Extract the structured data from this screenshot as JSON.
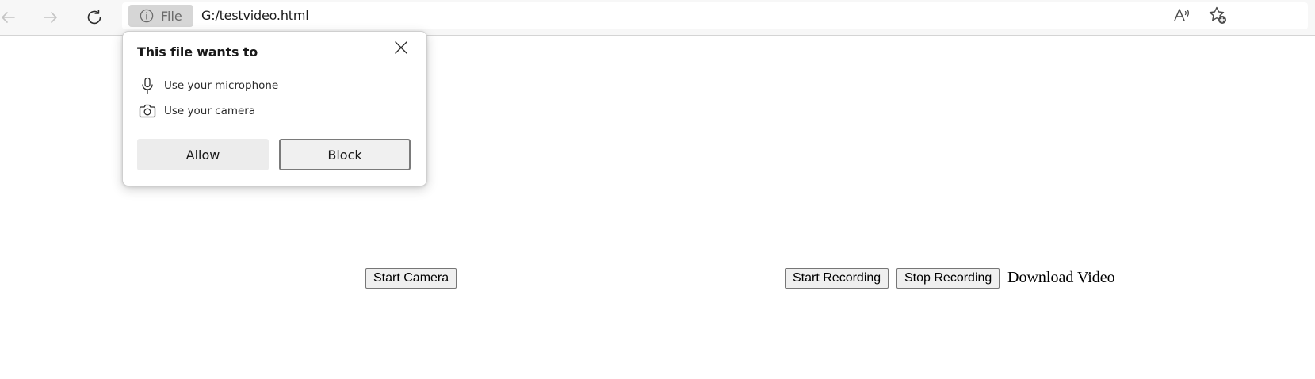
{
  "browser": {
    "site_chip_label": "File",
    "url": "G:/testvideo.html",
    "icons": {
      "back": "arrow-left-icon",
      "forward": "arrow-right-icon",
      "refresh": "refresh-icon",
      "site_info": "info-circle-icon",
      "read_aloud": "read-aloud-icon",
      "favorites": "star-add-icon"
    }
  },
  "permission_popup": {
    "title": "This file wants to",
    "permissions": [
      {
        "icon": "microphone-icon",
        "label": "Use your microphone"
      },
      {
        "icon": "camera-icon",
        "label": "Use your camera"
      }
    ],
    "allow_label": "Allow",
    "block_label": "Block",
    "close_icon": "close-icon"
  },
  "page": {
    "start_camera_label": "Start Camera",
    "start_recording_label": "Start Recording",
    "stop_recording_label": "Stop Recording",
    "download_label": "Download Video"
  }
}
